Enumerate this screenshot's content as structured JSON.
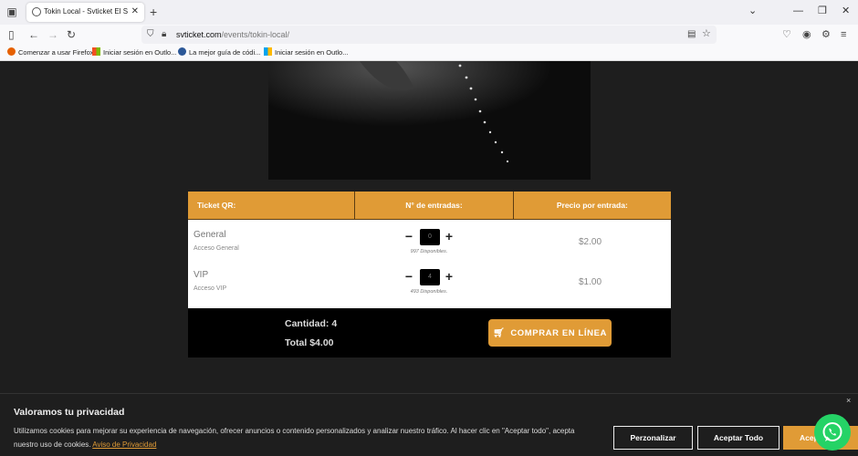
{
  "browser": {
    "tab_title": "Tokin Local - Svticket El Salvador",
    "tab_close": "✕",
    "new_tab": "+",
    "url_host": "svticket.com",
    "url_path": "/events/tokin-local/",
    "bookmarks": [
      {
        "label": "Comenzar a usar Firefox",
        "icon": "firefox-icon"
      },
      {
        "label": "Iniciar sesión en Outlo...",
        "icon": "microsoft-icon"
      },
      {
        "label": "La mejor guía de códi...",
        "icon": "globe-icon"
      },
      {
        "label": "Iniciar sesión en Outlo...",
        "icon": "microsoft-icon"
      }
    ]
  },
  "tickets": {
    "headers": [
      "Ticket QR:",
      "N° de entradas:",
      "Precio por entrada:"
    ],
    "rows": [
      {
        "name": "General",
        "desc": "Acceso General",
        "qty": "0",
        "available": "997 Disponibles.",
        "price": "$2.00"
      },
      {
        "name": "VIP",
        "desc": "Acceso VIP",
        "qty": "4",
        "available": "493 Disponibles.",
        "price": "$1.00"
      }
    ],
    "minus": "−",
    "plus": "+"
  },
  "summary": {
    "quantity": "Cantidad: 4",
    "total": "Total $4.00",
    "buy_label": "COMPRAR EN LÍNEA"
  },
  "cookie": {
    "title": "Valoramos tu privacidad",
    "text": "Utilizamos cookies para mejorar su experiencia de navegación, ofrecer anuncios o contenido personalizados y analizar nuestro tráfico. Al hacer clic en \"Aceptar todo\", acepta nuestro uso de cookies.",
    "link": "Aviso de Privacidad",
    "customize": "Perzonalizar",
    "accept_all": "Aceptar Todo",
    "accept": "Aceptar",
    "close": "×"
  },
  "colors": {
    "accent": "#e09b36",
    "whatsapp": "#25d366"
  }
}
